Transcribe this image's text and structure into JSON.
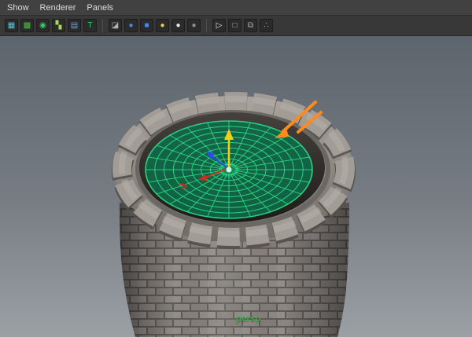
{
  "menu_bar": {
    "items": [
      {
        "label": "Show"
      },
      {
        "label": "Renderer"
      },
      {
        "label": "Panels"
      }
    ]
  },
  "toolbar": {
    "icons": [
      {
        "name": "panel-layout-icon",
        "glyph": "▦"
      },
      {
        "name": "render-region-icon",
        "glyph": "▩"
      },
      {
        "name": "snapshot-icon",
        "glyph": "◉"
      },
      {
        "name": "checker-icon",
        "glyph": "▚"
      },
      {
        "name": "film-gate-icon",
        "glyph": "▤"
      },
      {
        "name": "heads-up-text-icon",
        "glyph": "T"
      },
      {
        "name": "wireframe-cube-icon",
        "glyph": "◪"
      },
      {
        "name": "shaded-sphere-icon",
        "glyph": "●"
      },
      {
        "name": "textured-cube-icon",
        "glyph": "■"
      },
      {
        "name": "lights-sphere-icon",
        "glyph": "●"
      },
      {
        "name": "specular-sphere-icon",
        "glyph": "●"
      },
      {
        "name": "flat-sphere-icon",
        "glyph": "●"
      },
      {
        "name": "isolate-select-icon",
        "glyph": "▷"
      },
      {
        "name": "xray-cube-icon",
        "glyph": "□"
      },
      {
        "name": "duplicate-view-icon",
        "glyph": "⧉"
      },
      {
        "name": "hypergraph-icon",
        "glyph": "∴"
      }
    ]
  },
  "viewport": {
    "camera_label": "persp",
    "annotations": [
      {
        "name": "orange-arrow"
      }
    ],
    "colors": {
      "grid_green": "#2fe48b",
      "selection_fill": "#0c6c49",
      "annotation_orange": "#ff8a1e",
      "camera_label_color": "#3cab45",
      "manipulator_y": "#f2cf16",
      "manipulator_z": "#2b4bf2",
      "manipulator_x": "#d8291f"
    }
  }
}
